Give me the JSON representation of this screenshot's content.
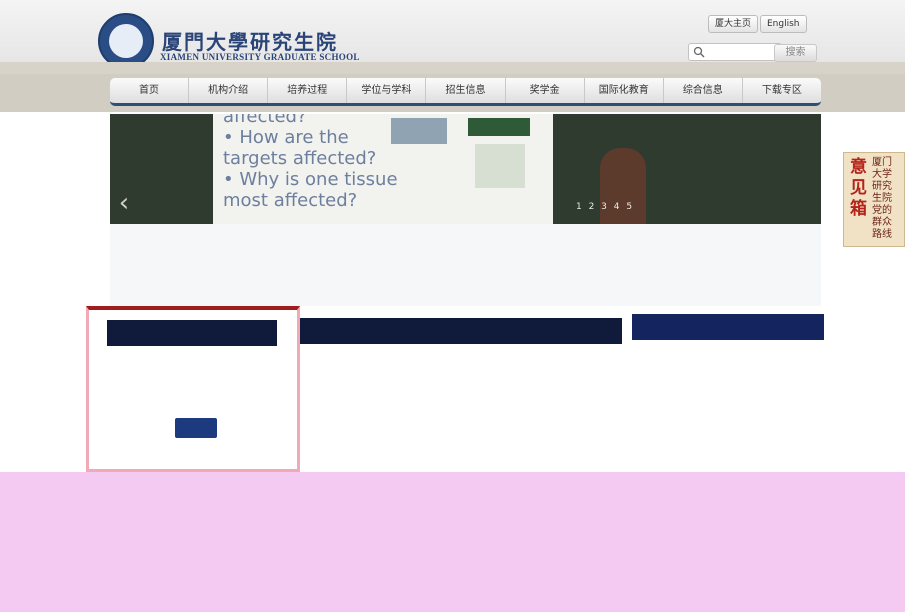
{
  "header": {
    "logo_cn": "厦門大學研究生院",
    "logo_en": "XIAMEN UNIVERSITY GRADUATE SCHOOL",
    "links": [
      "厦大主页",
      "English"
    ],
    "search_placeholder": "",
    "search_button": "搜索"
  },
  "nav": {
    "items": [
      "首页",
      "机构介绍",
      "培养过程",
      "学位与学科",
      "招生信息",
      "奖学金",
      "国际化教育",
      "综合信息",
      "下载专区"
    ]
  },
  "banner": {
    "slide_lines": [
      "affected?",
      "• How are the",
      "  targets affected?",
      "• Why is one tissue",
      "  most affected?"
    ],
    "prev_arrow": "‹",
    "dots": "1 2 3 4 5"
  },
  "feedback": {
    "big": "意见箱",
    "small": "厦门大学研究生院党的群众路线"
  },
  "colors": {
    "nav_accent": "#2e4e78",
    "panel_title_bg": "#101a3a",
    "panel_left_top": "#a11d1d",
    "footer_bg": "#f4c9f2"
  }
}
